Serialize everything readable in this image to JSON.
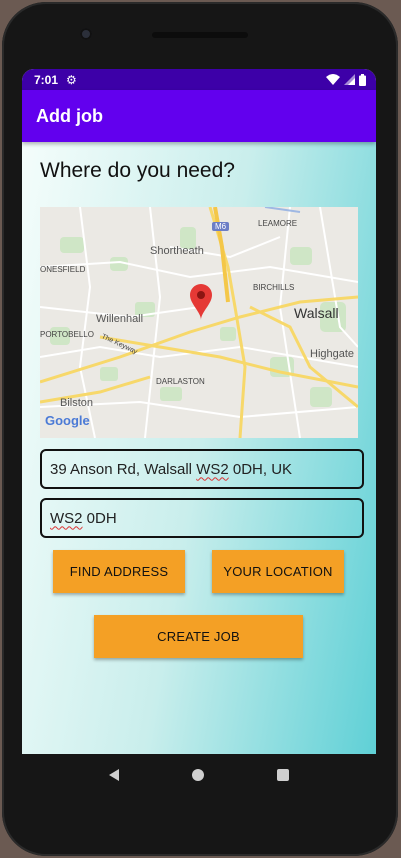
{
  "status": {
    "time": "7:01"
  },
  "appbar": {
    "title": "Add job"
  },
  "headline": "Where do you need?",
  "map": {
    "labels": {
      "m6": "M6",
      "leamore": "LEAMORE",
      "onesfield": "ONESFIELD",
      "shortheath": "Shortheath",
      "birchills": "BIRCHILLS",
      "walsall": "Walsall",
      "willenhall": "Willenhall",
      "portobello": "PORTOBELLO",
      "keyway": "The Keyway",
      "highgate": "Highgate",
      "darlaston": "DARLASTON",
      "bilston": "Bilston",
      "google": "Google"
    }
  },
  "address_field": {
    "prefix": "39 Anson Rd, Walsall ",
    "postcode": "WS2",
    "suffix": " 0DH, UK"
  },
  "postcode_field": {
    "postcode": "WS2",
    "suffix": " 0DH"
  },
  "buttons": {
    "find_address": "FIND ADDRESS",
    "your_location": "YOUR LOCATION",
    "create_job": "CREATE JOB"
  }
}
